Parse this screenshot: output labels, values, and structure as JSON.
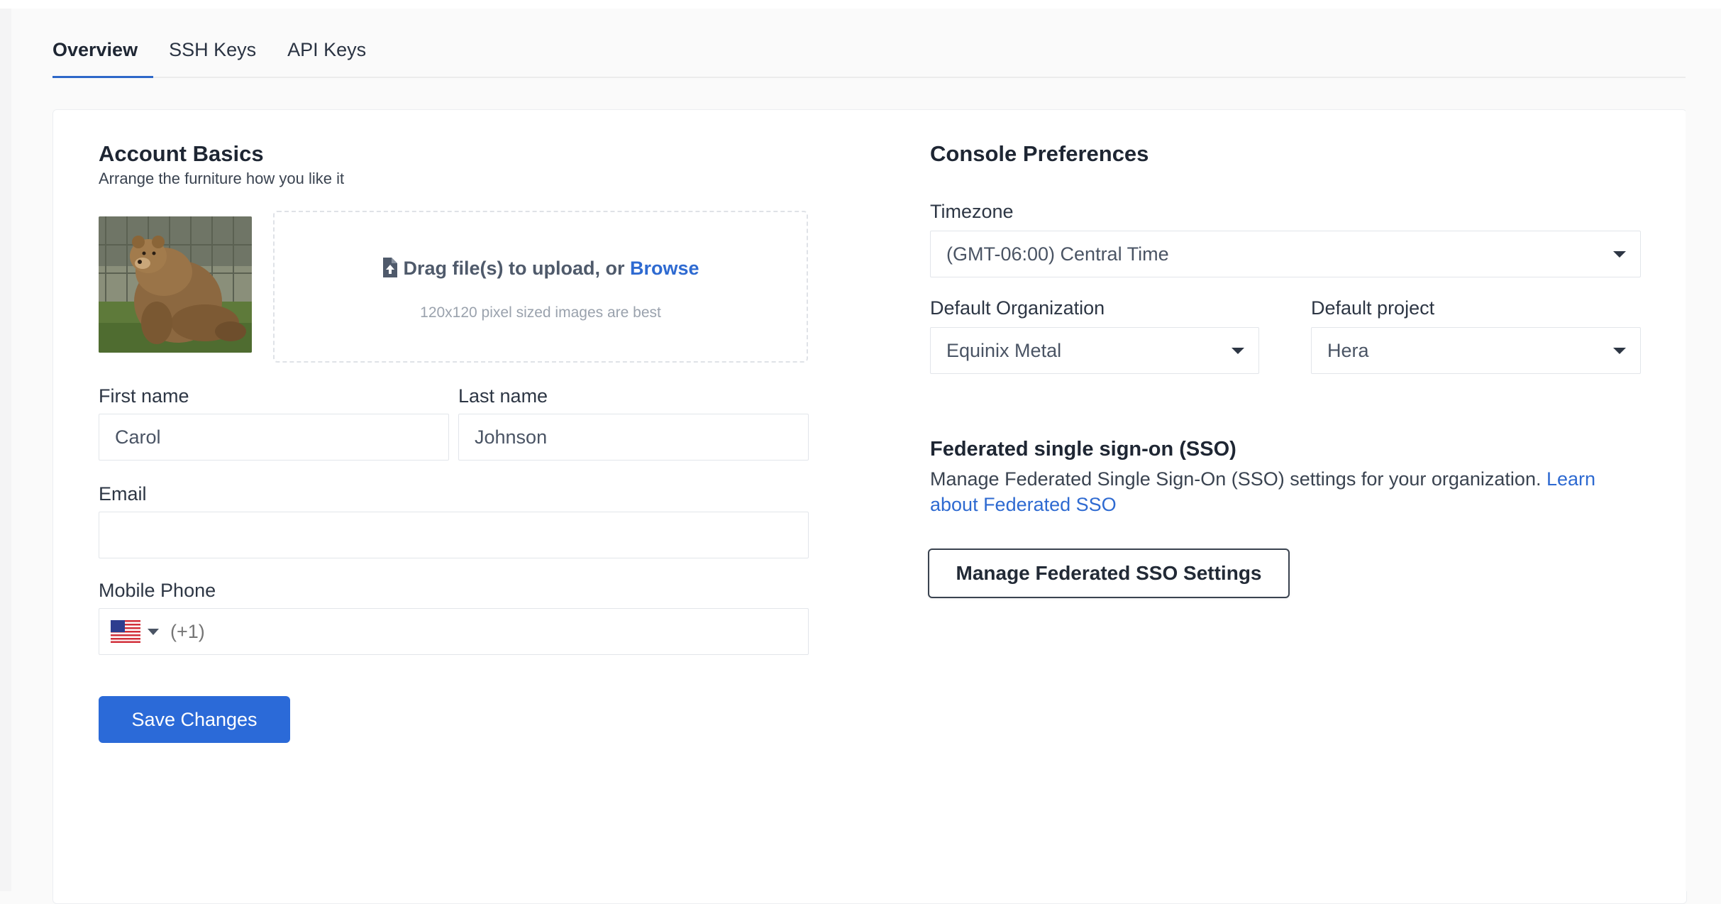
{
  "tabs": [
    {
      "label": "Overview",
      "active": true
    },
    {
      "label": "SSH Keys",
      "active": false
    },
    {
      "label": "API Keys",
      "active": false
    }
  ],
  "account": {
    "title": "Account Basics",
    "subtitle": "Arrange the furniture how you like it",
    "upload": {
      "text": "Drag file(s) to upload, or",
      "browse": "Browse",
      "hint": "120x120 pixel sized images are best"
    },
    "first_name": {
      "label": "First name",
      "value": "Carol"
    },
    "last_name": {
      "label": "Last name",
      "value": "Johnson"
    },
    "email": {
      "label": "Email",
      "value": ""
    },
    "phone": {
      "label": "Mobile Phone",
      "placeholder": "(+1)",
      "country": "us-flag-icon"
    },
    "save_label": "Save Changes"
  },
  "preferences": {
    "title": "Console Preferences",
    "timezone": {
      "label": "Timezone",
      "value": "(GMT-06:00) Central Time"
    },
    "organization": {
      "label": "Default Organization",
      "value": "Equinix Metal"
    },
    "project": {
      "label": "Default project",
      "value": "Hera"
    }
  },
  "sso": {
    "title": "Federated single sign-on (SSO)",
    "description": "Manage Federated Single Sign-On (SSO) settings for your organization.",
    "link_text": "Learn about Federated SSO",
    "button_label": "Manage Federated SSO Settings"
  },
  "colors": {
    "accent": "#2b6ad8",
    "link": "#2e6ad1",
    "text": "#222a36"
  }
}
